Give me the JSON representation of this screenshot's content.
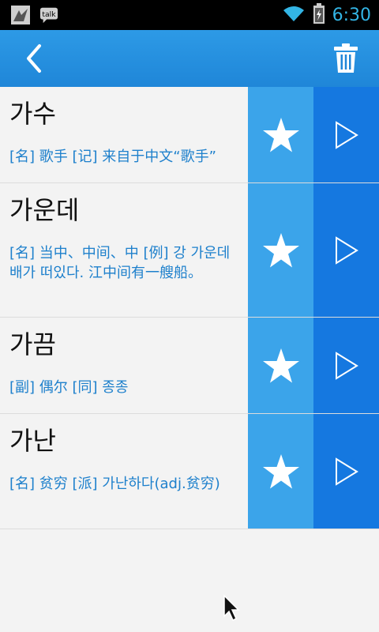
{
  "status_bar": {
    "left_icons": [
      "notification-app-icon",
      "talk-icon"
    ],
    "talk_label": "talk",
    "right_icons": [
      "wifi-icon",
      "battery-icon"
    ],
    "time": "6:30",
    "accent_color": "#33b5e5"
  },
  "app_bar": {
    "back_icon": "chevron-left-icon",
    "delete_icon": "trash-icon",
    "colors": {
      "top": "#2d9ae6",
      "bottom": "#1f86d8"
    }
  },
  "words": [
    {
      "word": "가수",
      "definition": "[名] 歌手 [记] 来自于中文“歌手”"
    },
    {
      "word": "가운데",
      "definition": "[名] 当中、中间、中 [例] 강 가운데 배가 떠있다. 江中间有一艘船。"
    },
    {
      "word": "가끔",
      "definition": "[副] 偶尔 [同] 종종"
    },
    {
      "word": "가난",
      "definition": "[名] 贫穷 [派] 가난하다(adj.贫穷)"
    }
  ],
  "row_actions": {
    "favorite_icon": "star-icon",
    "play_icon": "play-icon"
  },
  "colors": {
    "favorite_bg": "#3ba4ea",
    "play_bg": "#1578e0",
    "definition_text": "#1e80cc"
  }
}
